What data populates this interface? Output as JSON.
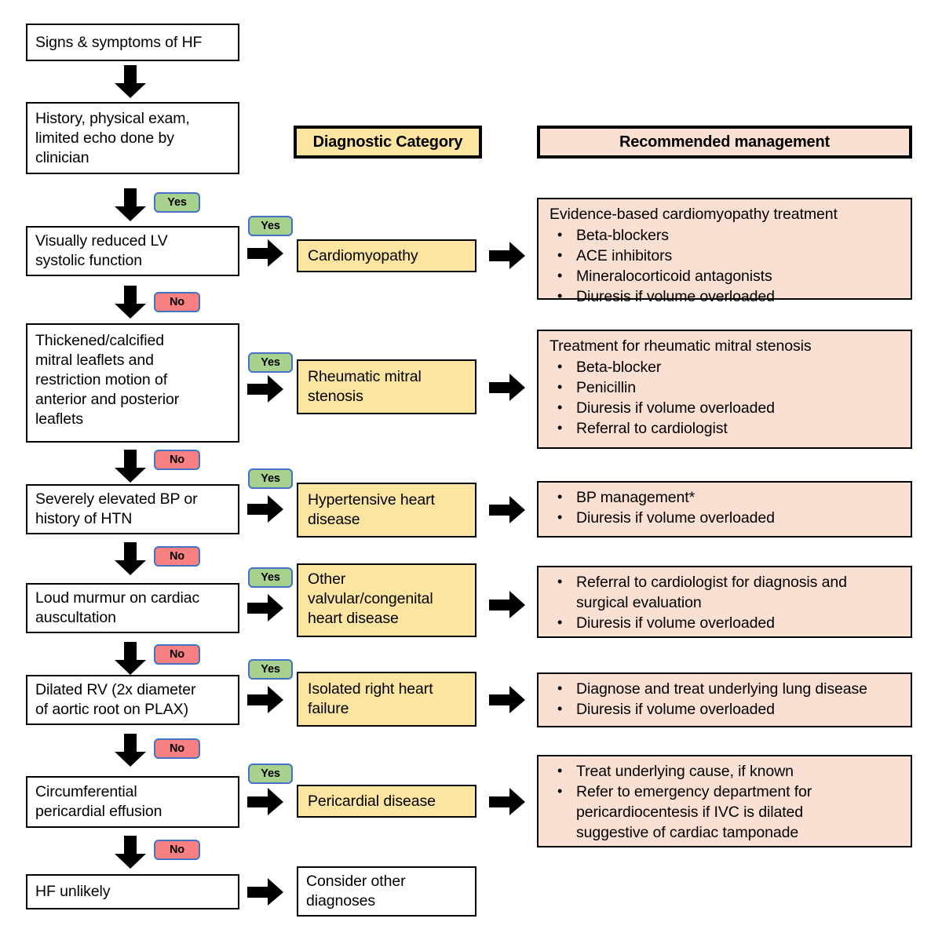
{
  "headers": {
    "diagnostic_category": "Diagnostic Category",
    "recommended_management": "Recommended management"
  },
  "labels": {
    "yes": "Yes",
    "no": "No"
  },
  "flow": {
    "start": "Signs & symptoms of HF",
    "workup": "History, physical exam,\nlimited echo done by\nclinician",
    "end": "HF unlikely",
    "end_action": "Consider other\ndiagnoses"
  },
  "rows": [
    {
      "question": "Visually reduced LV\nsystolic function",
      "category": "Cardiomyopathy",
      "management_lead": "Evidence-based cardiomyopathy treatment",
      "management_items": [
        "Beta-blockers",
        "ACE inhibitors",
        "Mineralocorticoid antagonists",
        "Diuresis if volume overloaded"
      ]
    },
    {
      "question": "Thickened/calcified\nmitral leaflets and\nrestriction motion of\nanterior and posterior\nleaflets",
      "category": "Rheumatic mitral\nstenosis",
      "management_lead": "Treatment for rheumatic mitral stenosis",
      "management_items": [
        "Beta-blocker",
        "Penicillin",
        "Diuresis if volume overloaded",
        "Referral to cardiologist"
      ]
    },
    {
      "question": "Severely elevated BP or\nhistory of HTN",
      "category": "Hypertensive heart\ndisease",
      "management_lead": "",
      "management_items": [
        "BP management*",
        "Diuresis if volume overloaded"
      ]
    },
    {
      "question": "Loud murmur on cardiac\nauscultation",
      "category": "Other\nvalvular/congenital\nheart disease",
      "management_lead": "",
      "management_items": [
        "Referral to cardiologist for diagnosis and\nsurgical evaluation",
        "Diuresis if volume overloaded"
      ]
    },
    {
      "question": "Dilated RV (2x diameter\nof aortic root on PLAX)",
      "category": "Isolated right heart\nfailure",
      "management_lead": "",
      "management_items": [
        "Diagnose and treat underlying lung disease",
        "Diuresis if volume overloaded"
      ]
    },
    {
      "question": "Circumferential\npericardial effusion",
      "category": "Pericardial disease",
      "management_lead": "",
      "management_items": [
        "Treat underlying cause, if known",
        "Refer to emergency department for\npericardiocentesis if IVC is dilated\nsuggestive of cardiac tamponade"
      ]
    }
  ],
  "colors": {
    "category_fill": "#FBE5A0",
    "management_fill": "#FAE0D2",
    "yes_fill": "#A9D18E",
    "no_fill": "#F98080",
    "badge_border": "#4472C4",
    "outline": "#000000"
  }
}
